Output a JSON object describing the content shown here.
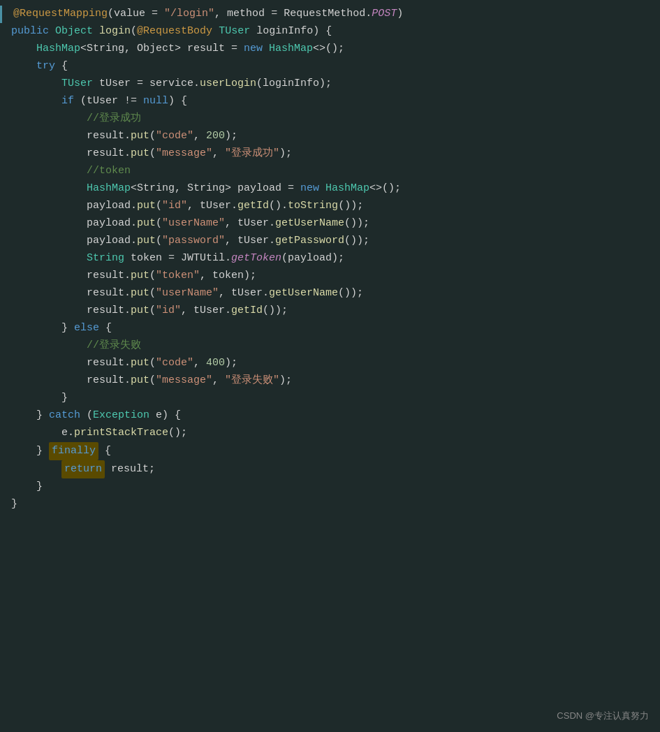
{
  "watermark": "CSDN @专注认真努力",
  "lines": [
    {
      "id": 1,
      "indent": 0,
      "tokens": [
        {
          "text": "@RequestMapping",
          "class": "annotation"
        },
        {
          "text": "(",
          "class": "plain"
        },
        {
          "text": "value",
          "class": "plain"
        },
        {
          "text": " = ",
          "class": "plain"
        },
        {
          "text": "\"/login\"",
          "class": "string"
        },
        {
          "text": ", ",
          "class": "plain"
        },
        {
          "text": "method",
          "class": "plain"
        },
        {
          "text": " = ",
          "class": "plain"
        },
        {
          "text": "RequestMethod.",
          "class": "plain"
        },
        {
          "text": "POST",
          "class": "method-italic"
        },
        {
          "text": ")",
          "class": "plain"
        }
      ]
    },
    {
      "id": 2,
      "indent": 0,
      "tokens": [
        {
          "text": "public",
          "class": "keyword"
        },
        {
          "text": " ",
          "class": "plain"
        },
        {
          "text": "Object",
          "class": "type"
        },
        {
          "text": " ",
          "class": "plain"
        },
        {
          "text": "login",
          "class": "method"
        },
        {
          "text": "(",
          "class": "plain"
        },
        {
          "text": "@RequestBody",
          "class": "annotation"
        },
        {
          "text": " ",
          "class": "plain"
        },
        {
          "text": "TUser",
          "class": "type"
        },
        {
          "text": " loginInfo) {",
          "class": "plain"
        }
      ]
    },
    {
      "id": 3,
      "indent": 2,
      "tokens": [
        {
          "text": "HashMap",
          "class": "type"
        },
        {
          "text": "<String, Object> result = ",
          "class": "plain"
        },
        {
          "text": "new",
          "class": "keyword"
        },
        {
          "text": " ",
          "class": "plain"
        },
        {
          "text": "HashMap",
          "class": "type"
        },
        {
          "text": "<>();",
          "class": "plain"
        }
      ]
    },
    {
      "id": 4,
      "indent": 2,
      "tokens": [
        {
          "text": "try",
          "class": "keyword"
        },
        {
          "text": " {",
          "class": "plain"
        }
      ]
    },
    {
      "id": 5,
      "indent": 4,
      "tokens": [
        {
          "text": "TUser",
          "class": "type"
        },
        {
          "text": " tUser = service.",
          "class": "plain"
        },
        {
          "text": "userLogin",
          "class": "method"
        },
        {
          "text": "(loginInfo);",
          "class": "plain"
        }
      ]
    },
    {
      "id": 6,
      "indent": 4,
      "tokens": [
        {
          "text": "if",
          "class": "keyword"
        },
        {
          "text": " (tUser != ",
          "class": "plain"
        },
        {
          "text": "null",
          "class": "keyword"
        },
        {
          "text": ") {",
          "class": "plain"
        }
      ]
    },
    {
      "id": 7,
      "indent": 6,
      "tokens": [
        {
          "text": "//登录成功",
          "class": "comment"
        }
      ]
    },
    {
      "id": 8,
      "indent": 6,
      "tokens": [
        {
          "text": "result.",
          "class": "plain"
        },
        {
          "text": "put",
          "class": "method"
        },
        {
          "text": "(",
          "class": "plain"
        },
        {
          "text": "\"code\"",
          "class": "string"
        },
        {
          "text": ", ",
          "class": "plain"
        },
        {
          "text": "200",
          "class": "number"
        },
        {
          "text": ");",
          "class": "plain"
        }
      ]
    },
    {
      "id": 9,
      "indent": 6,
      "tokens": [
        {
          "text": "result.",
          "class": "plain"
        },
        {
          "text": "put",
          "class": "method"
        },
        {
          "text": "(",
          "class": "plain"
        },
        {
          "text": "\"message\"",
          "class": "string"
        },
        {
          "text": ", ",
          "class": "plain"
        },
        {
          "text": "\"登录成功\"",
          "class": "string"
        },
        {
          "text": ");",
          "class": "plain"
        }
      ]
    },
    {
      "id": 10,
      "indent": 6,
      "tokens": [
        {
          "text": "//token",
          "class": "comment"
        }
      ]
    },
    {
      "id": 11,
      "indent": 6,
      "tokens": [
        {
          "text": "HashMap",
          "class": "type"
        },
        {
          "text": "<String, String> payload = ",
          "class": "plain"
        },
        {
          "text": "new",
          "class": "keyword"
        },
        {
          "text": " ",
          "class": "plain"
        },
        {
          "text": "HashMap",
          "class": "type"
        },
        {
          "text": "<>();",
          "class": "plain"
        }
      ]
    },
    {
      "id": 12,
      "indent": 6,
      "tokens": [
        {
          "text": "payload.",
          "class": "plain"
        },
        {
          "text": "put",
          "class": "method"
        },
        {
          "text": "(",
          "class": "plain"
        },
        {
          "text": "\"id\"",
          "class": "string"
        },
        {
          "text": ", tUser.",
          "class": "plain"
        },
        {
          "text": "getId",
          "class": "method"
        },
        {
          "text": "().",
          "class": "plain"
        },
        {
          "text": "toString",
          "class": "method"
        },
        {
          "text": "());",
          "class": "plain"
        }
      ]
    },
    {
      "id": 13,
      "indent": 6,
      "tokens": [
        {
          "text": "payload.",
          "class": "plain"
        },
        {
          "text": "put",
          "class": "method"
        },
        {
          "text": "(",
          "class": "plain"
        },
        {
          "text": "\"userName\"",
          "class": "string"
        },
        {
          "text": ", tUser.",
          "class": "plain"
        },
        {
          "text": "getUserName",
          "class": "method"
        },
        {
          "text": "());",
          "class": "plain"
        }
      ]
    },
    {
      "id": 14,
      "indent": 6,
      "tokens": [
        {
          "text": "payload.",
          "class": "plain"
        },
        {
          "text": "put",
          "class": "method"
        },
        {
          "text": "(",
          "class": "plain"
        },
        {
          "text": "\"password\"",
          "class": "string"
        },
        {
          "text": ", tUser.",
          "class": "plain"
        },
        {
          "text": "getPassword",
          "class": "method"
        },
        {
          "text": "());",
          "class": "plain"
        }
      ]
    },
    {
      "id": 15,
      "indent": 6,
      "tokens": [
        {
          "text": "String",
          "class": "type"
        },
        {
          "text": " token = ",
          "class": "plain"
        },
        {
          "text": "JWTUtil.",
          "class": "plain"
        },
        {
          "text": "getToken",
          "class": "method-italic"
        },
        {
          "text": "(payload);",
          "class": "plain"
        }
      ]
    },
    {
      "id": 16,
      "indent": 6,
      "tokens": [
        {
          "text": "result.",
          "class": "plain"
        },
        {
          "text": "put",
          "class": "method"
        },
        {
          "text": "(",
          "class": "plain"
        },
        {
          "text": "\"token\"",
          "class": "string"
        },
        {
          "text": ", token);",
          "class": "plain"
        }
      ]
    },
    {
      "id": 17,
      "indent": 6,
      "tokens": [
        {
          "text": "result.",
          "class": "plain"
        },
        {
          "text": "put",
          "class": "method"
        },
        {
          "text": "(",
          "class": "plain"
        },
        {
          "text": "\"userName\"",
          "class": "string"
        },
        {
          "text": ", tUser.",
          "class": "plain"
        },
        {
          "text": "getUserName",
          "class": "method"
        },
        {
          "text": "());",
          "class": "plain"
        }
      ]
    },
    {
      "id": 18,
      "indent": 6,
      "tokens": [
        {
          "text": "result.",
          "class": "plain"
        },
        {
          "text": "put",
          "class": "method"
        },
        {
          "text": "(",
          "class": "plain"
        },
        {
          "text": "\"id\"",
          "class": "string"
        },
        {
          "text": ", tUser.",
          "class": "plain"
        },
        {
          "text": "getId",
          "class": "method"
        },
        {
          "text": "());",
          "class": "plain"
        }
      ]
    },
    {
      "id": 19,
      "indent": 4,
      "tokens": [
        {
          "text": "} ",
          "class": "plain"
        },
        {
          "text": "else",
          "class": "keyword"
        },
        {
          "text": " {",
          "class": "plain"
        }
      ]
    },
    {
      "id": 20,
      "indent": 6,
      "tokens": [
        {
          "text": "//登录失败",
          "class": "comment"
        }
      ]
    },
    {
      "id": 21,
      "indent": 6,
      "tokens": [
        {
          "text": "result.",
          "class": "plain"
        },
        {
          "text": "put",
          "class": "method"
        },
        {
          "text": "(",
          "class": "plain"
        },
        {
          "text": "\"code\"",
          "class": "string"
        },
        {
          "text": ", ",
          "class": "plain"
        },
        {
          "text": "400",
          "class": "number"
        },
        {
          "text": ");",
          "class": "plain"
        }
      ]
    },
    {
      "id": 22,
      "indent": 6,
      "tokens": [
        {
          "text": "result.",
          "class": "plain"
        },
        {
          "text": "put",
          "class": "method"
        },
        {
          "text": "(",
          "class": "plain"
        },
        {
          "text": "\"message\"",
          "class": "string"
        },
        {
          "text": ", ",
          "class": "plain"
        },
        {
          "text": "\"登录失败\"",
          "class": "string"
        },
        {
          "text": ");",
          "class": "plain"
        }
      ]
    },
    {
      "id": 23,
      "indent": 4,
      "tokens": [
        {
          "text": "}",
          "class": "plain"
        }
      ]
    },
    {
      "id": 24,
      "indent": 2,
      "tokens": [
        {
          "text": "} ",
          "class": "plain"
        },
        {
          "text": "catch",
          "class": "keyword"
        },
        {
          "text": " (",
          "class": "plain"
        },
        {
          "text": "Exception",
          "class": "type"
        },
        {
          "text": " e) {",
          "class": "plain"
        }
      ]
    },
    {
      "id": 25,
      "indent": 4,
      "tokens": [
        {
          "text": "e.",
          "class": "plain"
        },
        {
          "text": "printStackTrace",
          "class": "method"
        },
        {
          "text": "();",
          "class": "plain"
        }
      ]
    },
    {
      "id": 26,
      "indent": 2,
      "highlight": true,
      "tokens": [
        {
          "text": "} ",
          "class": "plain"
        },
        {
          "text": "finally",
          "class": "keyword",
          "highlight": true
        },
        {
          "text": " {",
          "class": "plain"
        }
      ]
    },
    {
      "id": 27,
      "indent": 4,
      "tokens": [
        {
          "text": "return",
          "class": "keyword",
          "highlight": true
        },
        {
          "text": " result;",
          "class": "plain"
        }
      ]
    },
    {
      "id": 28,
      "indent": 2,
      "tokens": [
        {
          "text": "}",
          "class": "plain"
        }
      ]
    },
    {
      "id": 29,
      "indent": 0,
      "tokens": [
        {
          "text": "}",
          "class": "plain"
        }
      ]
    }
  ]
}
